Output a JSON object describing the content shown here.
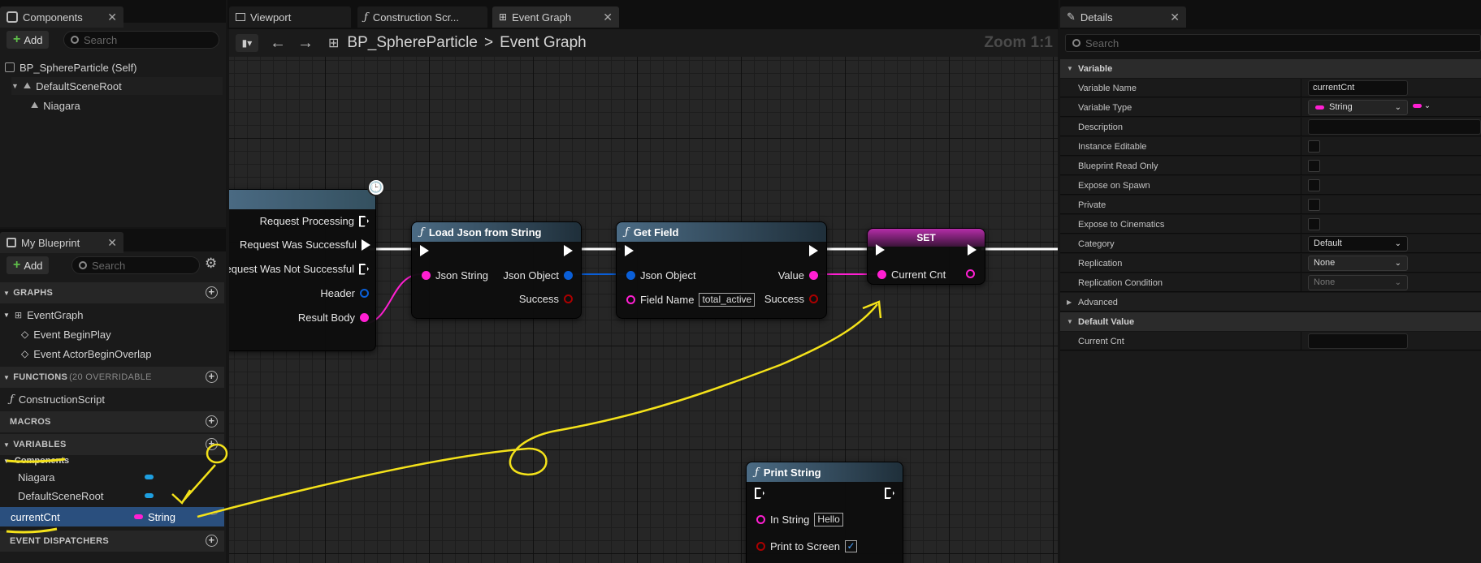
{
  "components_panel": {
    "tab_label": "Components",
    "add_label": "Add",
    "search_placeholder": "Search",
    "tree": [
      {
        "label": "BP_SphereParticle (Self)"
      },
      {
        "label": "DefaultSceneRoot"
      },
      {
        "label": "Niagara"
      }
    ]
  },
  "editor_tabs": [
    {
      "label": "Viewport"
    },
    {
      "label": "Construction Scr..."
    },
    {
      "label": "Event Graph"
    }
  ],
  "toolbar": {
    "breadcrumb_root": "BP_SphereParticle",
    "breadcrumb_sep": ">",
    "breadcrumb_leaf": "Event Graph",
    "zoom": "Zoom 1:1"
  },
  "my_blueprint": {
    "tab_label": "My Blueprint",
    "add_label": "Add",
    "search_placeholder": "Search",
    "graphs_header": "GRAPHS",
    "graphs": [
      "EventGraph",
      "Event BeginPlay",
      "Event ActorBeginOverlap"
    ],
    "functions_header": "FUNCTIONS",
    "functions_sub": "(20 OVERRIDABLE",
    "functions": [
      "ConstructionScript"
    ],
    "macros_header": "MACROS",
    "variables_header": "VARIABLES",
    "components_group": "Components",
    "component_vars": [
      "Niagara",
      "DefaultSceneRoot"
    ],
    "selected_var": {
      "name": "currentCnt",
      "type": "String"
    },
    "dispatchers_header": "EVENT DISPATCHERS"
  },
  "graph": {
    "request_node": {
      "pins": [
        "Request Processing",
        "Request Was Successful",
        "Request Was Not Successful",
        "Header",
        "Result Body"
      ]
    },
    "load_json_node": {
      "title": "Load Json from String",
      "in_pin": "Json String",
      "out_pins": [
        "Json Object",
        "Success"
      ]
    },
    "get_field_node": {
      "title": "Get Field",
      "in_pins": [
        "Json Object",
        "Field Name"
      ],
      "field_value": "total_active",
      "out_pins": [
        "Value",
        "Success"
      ]
    },
    "set_node": {
      "title": "SET",
      "pin": "Current Cnt"
    },
    "print_node": {
      "title": "Print String",
      "in_string_label": "In String",
      "in_string_value": "Hello",
      "print_screen_label": "Print to Screen"
    }
  },
  "details": {
    "tab_label": "Details",
    "search_placeholder": "Search",
    "variable_section": "Variable",
    "rows": {
      "variable_name_label": "Variable Name",
      "variable_name_value": "currentCnt",
      "variable_type_label": "Variable Type",
      "variable_type_value": "String",
      "description_label": "Description",
      "instance_editable_label": "Instance Editable",
      "read_only_label": "Blueprint Read Only",
      "expose_spawn_label": "Expose on Spawn",
      "private_label": "Private",
      "expose_cinematics_label": "Expose to Cinematics",
      "category_label": "Category",
      "category_value": "Default",
      "replication_label": "Replication",
      "replication_value": "None",
      "replication_condition_label": "Replication Condition",
      "replication_condition_value": "None"
    },
    "advanced_section": "Advanced",
    "default_value_section": "Default Value",
    "current_cnt_label": "Current Cnt"
  },
  "colors": {
    "string_pin": "#ff1fd2",
    "object_pin": "#0a5fd8",
    "annotation": "#f4e21a"
  }
}
